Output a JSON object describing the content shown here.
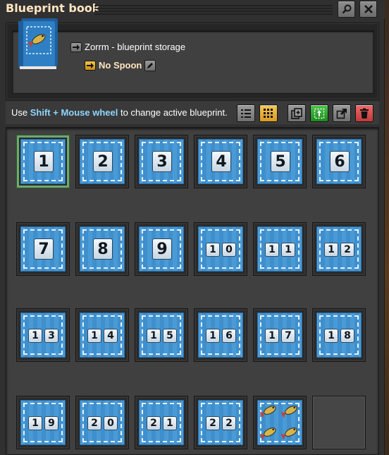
{
  "window": {
    "title": "Blueprint book"
  },
  "header": {
    "book_name": "Zorrm - blueprint storage",
    "active_blueprint": "No Spoon"
  },
  "toolbar": {
    "hint_prefix": "Use",
    "hint_keys": "Shift + Mouse wheel",
    "hint_suffix": "to change active blueprint."
  },
  "slots": [
    {
      "label": "1",
      "active": true
    },
    {
      "label": "2"
    },
    {
      "label": "3"
    },
    {
      "label": "4"
    },
    {
      "label": "5"
    },
    {
      "label": "6"
    },
    {
      "label": "7"
    },
    {
      "label": "8"
    },
    {
      "label": "9"
    },
    {
      "label": "10"
    },
    {
      "label": "11"
    },
    {
      "label": "12"
    },
    {
      "label": "13"
    },
    {
      "label": "14"
    },
    {
      "label": "15"
    },
    {
      "label": "16"
    },
    {
      "label": "17"
    },
    {
      "label": "18"
    },
    {
      "label": "19"
    },
    {
      "label": "20"
    },
    {
      "label": "21"
    },
    {
      "label": "22"
    },
    {
      "icon": "fish-icon"
    },
    {
      "empty": true
    }
  ],
  "colors": {
    "accent_keys": "#8fd6ff",
    "active_slot": "#6fa86f",
    "blueprint_blue": "#4a9ad6"
  }
}
